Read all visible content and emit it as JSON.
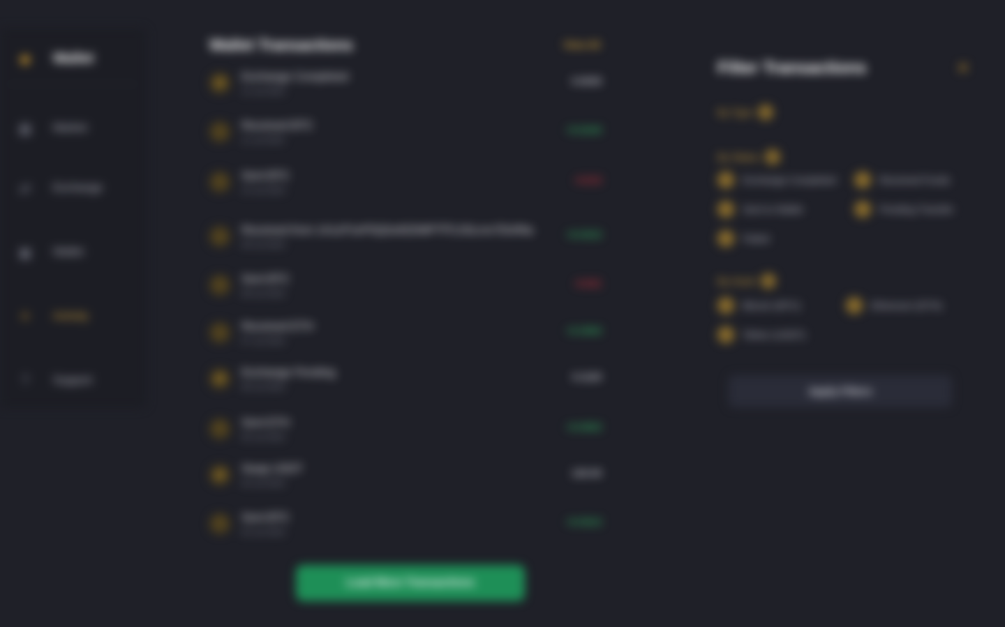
{
  "sidebar": {
    "logo": {
      "label": "Wallet",
      "icon": "logo-icon"
    },
    "items": [
      {
        "label": "Market",
        "icon": "chart-icon"
      },
      {
        "label": "Exchange",
        "icon": "swap-icon"
      },
      {
        "label": "Wallet",
        "icon": "wallet-icon"
      },
      {
        "label": "Activity",
        "icon": "activity-icon",
        "active": true
      },
      {
        "label": "Support",
        "icon": "help-icon"
      }
    ]
  },
  "list": {
    "title": "Wallet Transactions",
    "see_all": "View All",
    "rows": [
      {
        "title": "Exchange Completed",
        "date": "12 Jul 2023",
        "amount": "0.0035",
        "kind": "neutral"
      },
      {
        "title": "Received BTC",
        "date": "11 Jul 2023",
        "amount": "+0.0240",
        "kind": "pos"
      },
      {
        "title": "Sent BTC",
        "date": "10 Jul 2023",
        "amount": "-0.013",
        "kind": "neg"
      },
      {
        "title": "Received from 1A1zP1eP5QGefi2DMPTfTL5SLmv7DivfNa",
        "date": "09 Jul 2023",
        "amount": "+0.0410",
        "kind": "pos"
      },
      {
        "title": "Sent BTC",
        "date": "08 Jul 2023",
        "amount": "-0.021",
        "kind": "neg"
      },
      {
        "title": "Received ETH",
        "date": "07 Jul 2023",
        "amount": "+0.3500",
        "kind": "pos"
      },
      {
        "title": "Exchange Pending",
        "date": "06 Jul 2023",
        "amount": "0.1120",
        "kind": "neutral"
      },
      {
        "title": "Sent ETH",
        "date": "05 Jul 2023",
        "amount": "+0.0920",
        "kind": "pos"
      },
      {
        "title": "Swap USDT",
        "date": "04 Jul 2023",
        "amount": "120.00",
        "kind": "neutral"
      },
      {
        "title": "Sent BTC",
        "date": "03 Jul 2023",
        "amount": "+0.0510",
        "kind": "pos"
      }
    ],
    "primary_button": "Load More Transactions"
  },
  "filter": {
    "title": "Filter Transactions",
    "group1": {
      "label": "By Type"
    },
    "group2": {
      "label": "By Status",
      "options": [
        "Exchange Completed",
        "Received Funds",
        "Sent to Wallet",
        "Pending Transfer",
        "Failed"
      ]
    },
    "group3": {
      "label": "By Asset",
      "options": [
        "Bitcoin (BTC)",
        "Ethereum (ETH)",
        "Tether (USDT)"
      ]
    },
    "apply_button": "Apply Filters"
  },
  "colors": {
    "accent": "#d6a53a",
    "positive": "#2fa35a",
    "negative": "#c0313b",
    "primary_button": "#1e8f57"
  }
}
